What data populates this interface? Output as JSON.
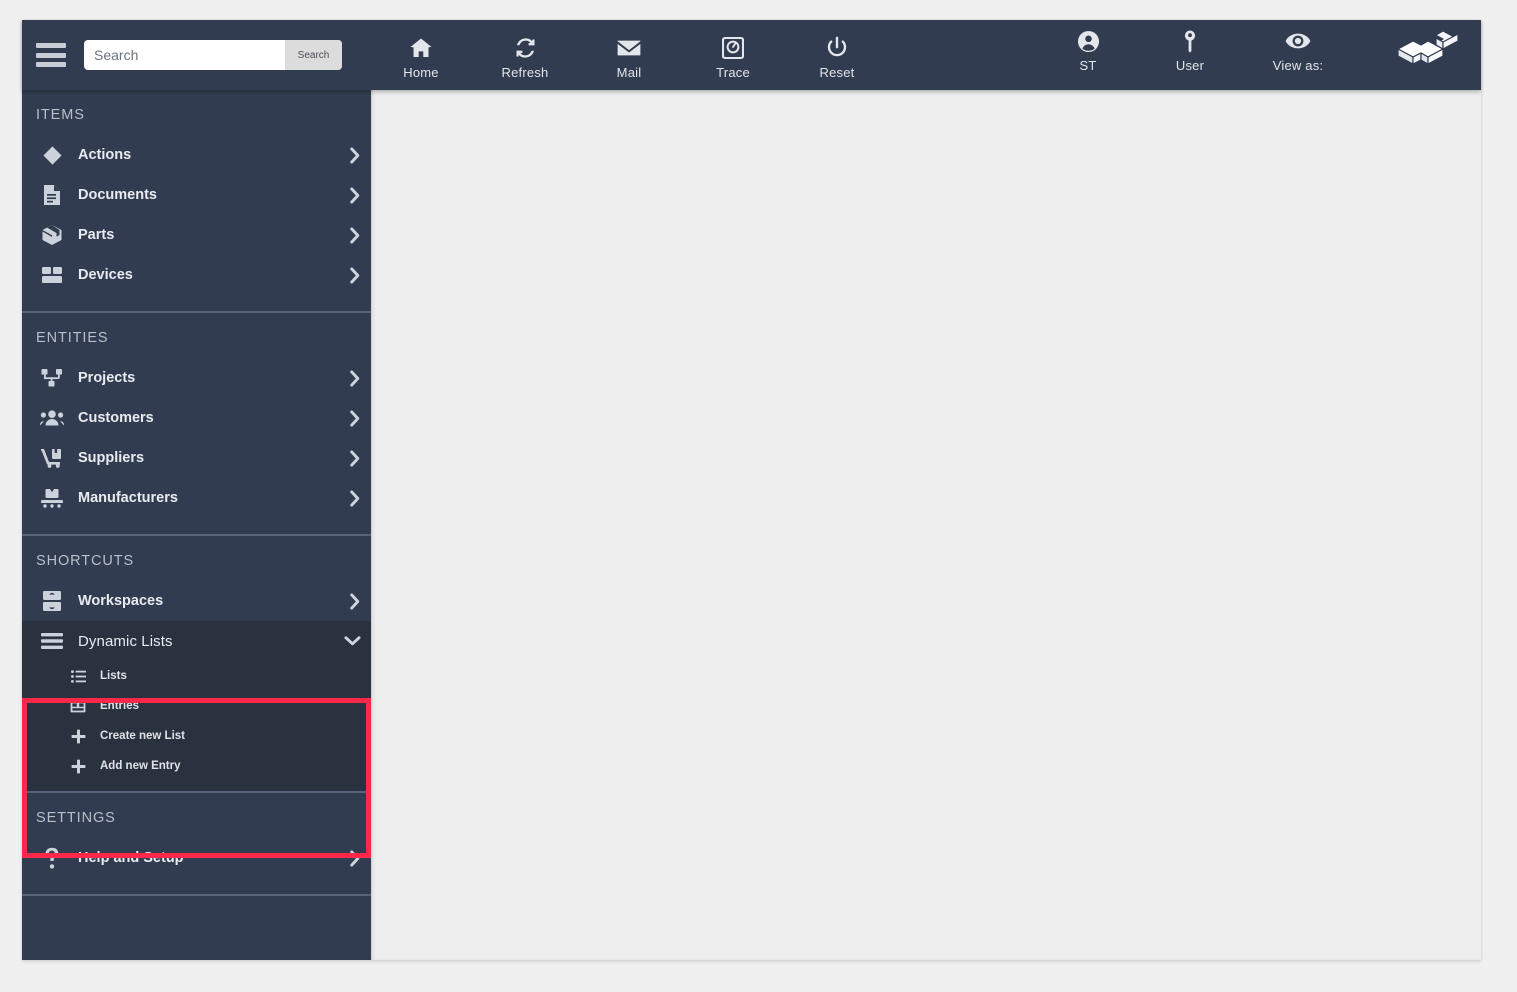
{
  "header": {
    "menu_icon": "hamburger-icon",
    "search": {
      "placeholder": "Search",
      "value": "",
      "button_label": "Search"
    },
    "tools": [
      {
        "label": "Home",
        "icon": "home-icon"
      },
      {
        "label": "Refresh",
        "icon": "refresh-icon"
      },
      {
        "label": "Mail",
        "icon": "mail-icon"
      },
      {
        "label": "Trace",
        "icon": "trace-gauge-icon"
      },
      {
        "label": "Reset",
        "icon": "power-reset-icon"
      }
    ],
    "right_tools": [
      {
        "label": "ST",
        "icon": "user-circle-icon"
      },
      {
        "label": "User",
        "icon": "key-icon"
      },
      {
        "label": "View as:",
        "icon": "eye-icon"
      }
    ],
    "logo": "isometric-blocks-logo"
  },
  "sidebar": {
    "sections": [
      {
        "title": "ITEMS",
        "items": [
          {
            "label": "Actions",
            "icon": "diamond-icon",
            "chevron": "chevron-right-icon"
          },
          {
            "label": "Documents",
            "icon": "document-icon",
            "chevron": "chevron-right-icon"
          },
          {
            "label": "Parts",
            "icon": "box-icon",
            "chevron": "chevron-right-icon"
          },
          {
            "label": "Devices",
            "icon": "device-icon",
            "chevron": "chevron-right-icon"
          }
        ]
      },
      {
        "title": "ENTITIES",
        "items": [
          {
            "label": "Projects",
            "icon": "sitemap-icon",
            "chevron": "chevron-right-icon"
          },
          {
            "label": "Customers",
            "icon": "users-icon",
            "chevron": "chevron-right-icon"
          },
          {
            "label": "Suppliers",
            "icon": "dolly-icon",
            "chevron": "chevron-right-icon"
          },
          {
            "label": "Manufacturers",
            "icon": "conveyor-icon",
            "chevron": "chevron-right-icon"
          }
        ]
      },
      {
        "title": "SHORTCUTS",
        "items": [
          {
            "label": "Workspaces",
            "icon": "archive-icon",
            "chevron": "chevron-right-icon"
          }
        ],
        "expanded_group": {
          "label": "Dynamic Lists",
          "icon": "bars-icon",
          "chevron": "chevron-down-icon",
          "sub_items": [
            {
              "label": "Lists",
              "icon": "list-ul-icon"
            },
            {
              "label": "Entries",
              "icon": "table-entry-icon"
            },
            {
              "label": "Create new List",
              "icon": "plus-icon"
            },
            {
              "label": "Add new Entry",
              "icon": "plus-icon"
            }
          ]
        }
      },
      {
        "title": "SETTINGS",
        "items": [
          {
            "label": "Help and Setup",
            "icon": "question-mark-icon",
            "chevron": "chevron-right-icon"
          }
        ]
      }
    ]
  },
  "highlight": {
    "color": "#fb2849",
    "target": "Dynamic Lists"
  },
  "colors": {
    "header_bg": "#323c50",
    "sidebar_bg": "#323c50",
    "expanded_bg": "#2b323f",
    "content_bg": "#eeeeee",
    "page_bg": "#f0f0f0",
    "divider": "#59637a",
    "text": "#e8ebf0",
    "muted_text": "#b9bfca"
  }
}
